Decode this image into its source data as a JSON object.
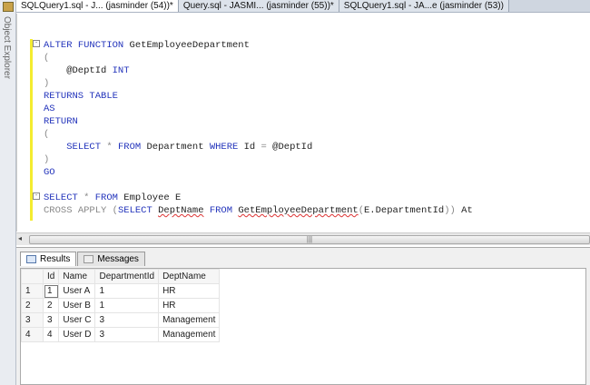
{
  "sidebar": {
    "label": "Object Explorer"
  },
  "tabs": [
    {
      "label": "SQLQuery1.sql - J... (jasminder (54))*",
      "active": true
    },
    {
      "label": "Query.sql - JASMI... (jasminder (55))*",
      "active": false
    },
    {
      "label": "SQLQuery1.sql - JA...e (jasminder (53))",
      "active": false
    }
  ],
  "editor": {
    "lines": [
      "ALTER FUNCTION GetEmployeeDepartment",
      "(",
      "    @DeptId INT",
      ")",
      "RETURNS TABLE",
      "AS",
      "RETURN",
      "(",
      "    SELECT * FROM Department WHERE Id = @DeptId",
      ")",
      "GO",
      "",
      "SELECT * FROM Employee E",
      "CROSS APPLY (SELECT DeptName FROM GetEmployeeDepartment(E.DepartmentId)) At"
    ]
  },
  "results": {
    "tabs": [
      "Results",
      "Messages"
    ],
    "columns": [
      "",
      "Id",
      "Name",
      "DepartmentId",
      "DeptName"
    ],
    "rows": [
      [
        "1",
        "1",
        "User A",
        "1",
        "HR"
      ],
      [
        "2",
        "2",
        "User B",
        "1",
        "HR"
      ],
      [
        "3",
        "3",
        "User C",
        "3",
        "Management"
      ],
      [
        "4",
        "4",
        "User D",
        "3",
        "Management"
      ]
    ]
  }
}
